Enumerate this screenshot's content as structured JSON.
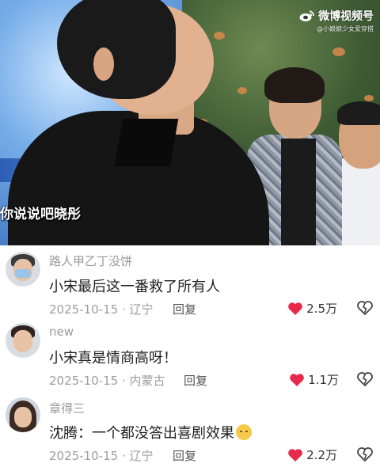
{
  "video": {
    "subtitle": "你说说吧晓彤",
    "watermark_brand": "微博视频号",
    "watermark_sub": "@小娘娘少女爱穿搭"
  },
  "comments": [
    {
      "username": "路人甲乙丁没饼",
      "text": "小宋最后这一番救了所有人",
      "date_location": "2025-10-15 · 辽宁",
      "reply_label": "回复",
      "likes": "2.5万"
    },
    {
      "username": "new",
      "text": "小宋真是情商高呀！",
      "date_location": "2025-10-15 · 内蒙古",
      "reply_label": "回复",
      "likes": "1.1万"
    },
    {
      "username": "章得三",
      "text": "沈腾：一个都没答出喜剧效果",
      "date_location": "2025-10-15 · 辽宁",
      "reply_label": "回复",
      "likes": "2.2万"
    }
  ],
  "colors": {
    "like_heart": "#e8294c",
    "username": "#9a9a9a",
    "meta": "#9d9d9d",
    "text": "#1f1f1f"
  },
  "icons": [
    "weibo-video-logo",
    "heart-icon",
    "broken-heart-icon",
    "emoji-icon"
  ]
}
